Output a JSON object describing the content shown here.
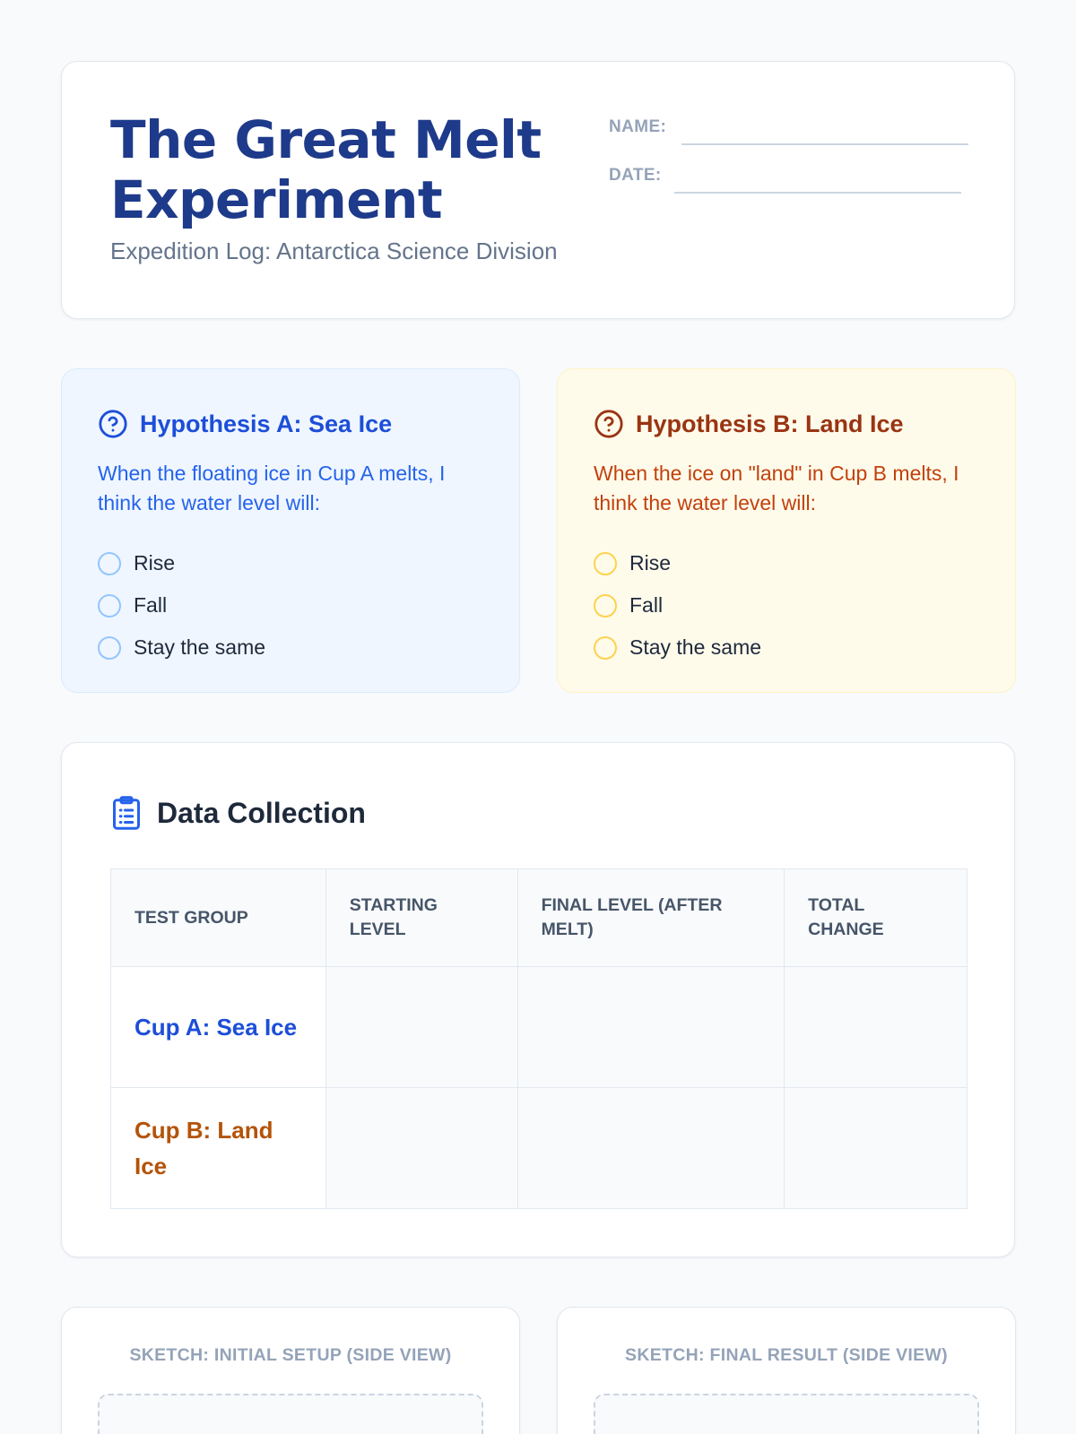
{
  "header": {
    "title": "The Great Melt Experiment",
    "subtitle": "Expedition Log: Antarctica Science Division",
    "name_label": "NAME:",
    "date_label": "DATE:"
  },
  "hypothesis_a": {
    "title": "Hypothesis A: Sea Ice",
    "text": "When the floating ice in Cup A melts, I think the water level will:",
    "options": [
      "Rise",
      "Fall",
      "Stay the same"
    ],
    "accent": "#1d4ed8",
    "text_color": "#2563eb",
    "radio_color": "#93c5fd"
  },
  "hypothesis_b": {
    "title": "Hypothesis B: Land Ice",
    "text": "When the ice on \"land\" in Cup B melts, I think the water level will:",
    "options": [
      "Rise",
      "Fall",
      "Stay the same"
    ],
    "accent": "#9a3412",
    "text_color": "#c2410c",
    "radio_color": "#fcd34d"
  },
  "data_collection": {
    "title": "Data Collection",
    "icon": "clipboard-icon",
    "columns": [
      "Test Group",
      "Starting Level",
      "Final Level (After Melt)",
      "Total Change"
    ],
    "rows": [
      {
        "group": "Cup A: Sea Ice",
        "color": "#1d4ed8"
      },
      {
        "group": "Cup B: Land Ice",
        "color": "#b45309"
      }
    ]
  },
  "sketches": {
    "initial_label": "SKETCH: INITIAL SETUP (SIDE VIEW)",
    "final_label": "SKETCH: FINAL RESULT (SIDE VIEW)"
  }
}
